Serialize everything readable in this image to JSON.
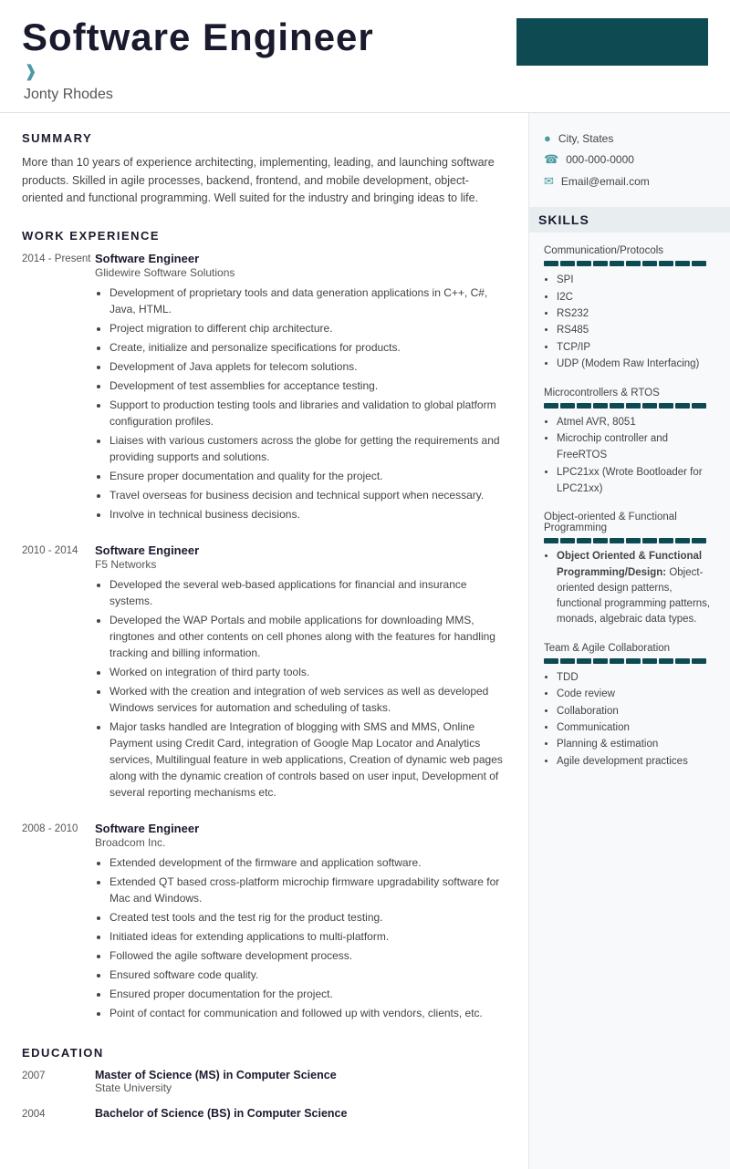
{
  "header": {
    "job_title": "Software Engineer",
    "candidate_name": "Jonty Rhodes"
  },
  "contact": {
    "location": "City, States",
    "phone": "000-000-0000",
    "email": "Email@email.com"
  },
  "summary": {
    "title": "SUMMARY",
    "text": "More than 10 years of experience architecting, implementing, leading, and launching software products. Skilled in agile processes, backend, frontend, and mobile development, object-oriented and functional programming. Well suited for the industry and bringing ideas to life."
  },
  "work_experience": {
    "title": "WORK EXPERIENCE",
    "jobs": [
      {
        "dates": "2014 - Present",
        "title": "Software Engineer",
        "company": "Glidewire Software Solutions",
        "bullets": [
          "Development of proprietary tools and data generation applications in C++, C#, Java, HTML.",
          "Project migration to different chip architecture.",
          "Create, initialize and personalize specifications for products.",
          "Development of Java applets for telecom solutions.",
          "Development of test assemblies for acceptance testing.",
          "Support to production testing tools and libraries and validation to global platform configuration profiles.",
          "Liaises with various customers across the globe for getting the requirements and providing supports and solutions.",
          "Ensure proper documentation and quality for the project.",
          "Travel overseas for business decision and technical support when necessary.",
          "Involve in technical business decisions."
        ]
      },
      {
        "dates": "2010 - 2014",
        "title": "Software Engineer",
        "company": "F5 Networks",
        "bullets": [
          "Developed the several web-based applications for financial and insurance systems.",
          "Developed the WAP Portals and mobile applications for downloading MMS, ringtones and other contents on cell phones along with the features for handling tracking and billing information.",
          "Worked on integration of third party tools.",
          "Worked with the creation and integration of web services as well as developed Windows services for automation and scheduling of tasks.",
          "Major tasks handled are Integration of blogging with SMS and MMS, Online Payment using Credit Card, integration of Google Map Locator and Analytics services, Multilingual feature in web applications, Creation of dynamic web pages along with the dynamic creation of controls based on user input, Development of several reporting mechanisms etc."
        ]
      },
      {
        "dates": "2008 - 2010",
        "title": "Software Engineer",
        "company": "Broadcom Inc.",
        "bullets": [
          "Extended development of the firmware and application software.",
          "Extended QT based cross-platform microchip firmware upgradability software for Mac and Windows.",
          "Created test tools and the test rig for the product testing.",
          "Initiated ideas for extending applications to multi-platform.",
          "Followed the agile software development process.",
          "Ensured software code quality.",
          "Ensured proper documentation for the project.",
          "Point of contact for communication and followed up with vendors, clients, etc."
        ]
      }
    ]
  },
  "education": {
    "title": "EDUCATION",
    "items": [
      {
        "year": "2007",
        "degree": "Master of Science (MS) in Computer Science",
        "school": "State University"
      },
      {
        "year": "2004",
        "degree": "Bachelor of Science (BS) in Computer Science",
        "school": ""
      }
    ]
  },
  "skills": {
    "title": "SKILLS",
    "groups": [
      {
        "name": "Communication/Protocols",
        "bar_filled": 10,
        "bar_total": 10,
        "items": [
          "SPI",
          "I2C",
          "RS232",
          "RS485",
          "TCP/IP",
          "UDP (Modem Raw Interfacing)"
        ]
      },
      {
        "name": "Microcontrollers & RTOS",
        "bar_filled": 10,
        "bar_total": 10,
        "items": [
          "Atmel AVR, 8051",
          "Microchip controller and FreeRTOS",
          "LPC21xx (Wrote Bootloader for LPC21xx)"
        ]
      },
      {
        "name": "Object-oriented & Functional Programming",
        "bar_filled": 10,
        "bar_total": 10,
        "items_bold": [
          "Object Oriented & Functional Programming/Design:"
        ],
        "items_normal": " Object-oriented design patterns, functional programming patterns, monads, algebraic data types."
      },
      {
        "name": "Team & Agile Collaboration",
        "bar_filled": 10,
        "bar_total": 10,
        "items": [
          "TDD",
          "Code review",
          "Collaboration",
          "Communication",
          "Planning & estimation",
          "Agile development practices"
        ]
      }
    ]
  }
}
